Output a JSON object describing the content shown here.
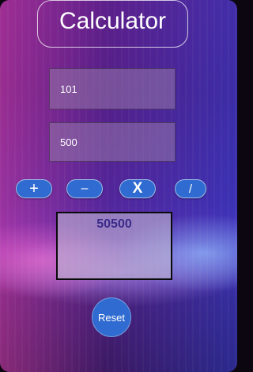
{
  "header": {
    "title": "Calculator"
  },
  "inputs": {
    "first_value": "101",
    "second_value": "500"
  },
  "operators": {
    "add_label": "+",
    "subtract_label": "–",
    "multiply_label": "X",
    "divide_label": "/"
  },
  "result": {
    "value": "50500"
  },
  "actions": {
    "reset_label": "Reset"
  },
  "colors": {
    "button_blue": "#2f6bd0",
    "result_text": "#3a2a8a",
    "background_purple": "#3b0f5a"
  }
}
